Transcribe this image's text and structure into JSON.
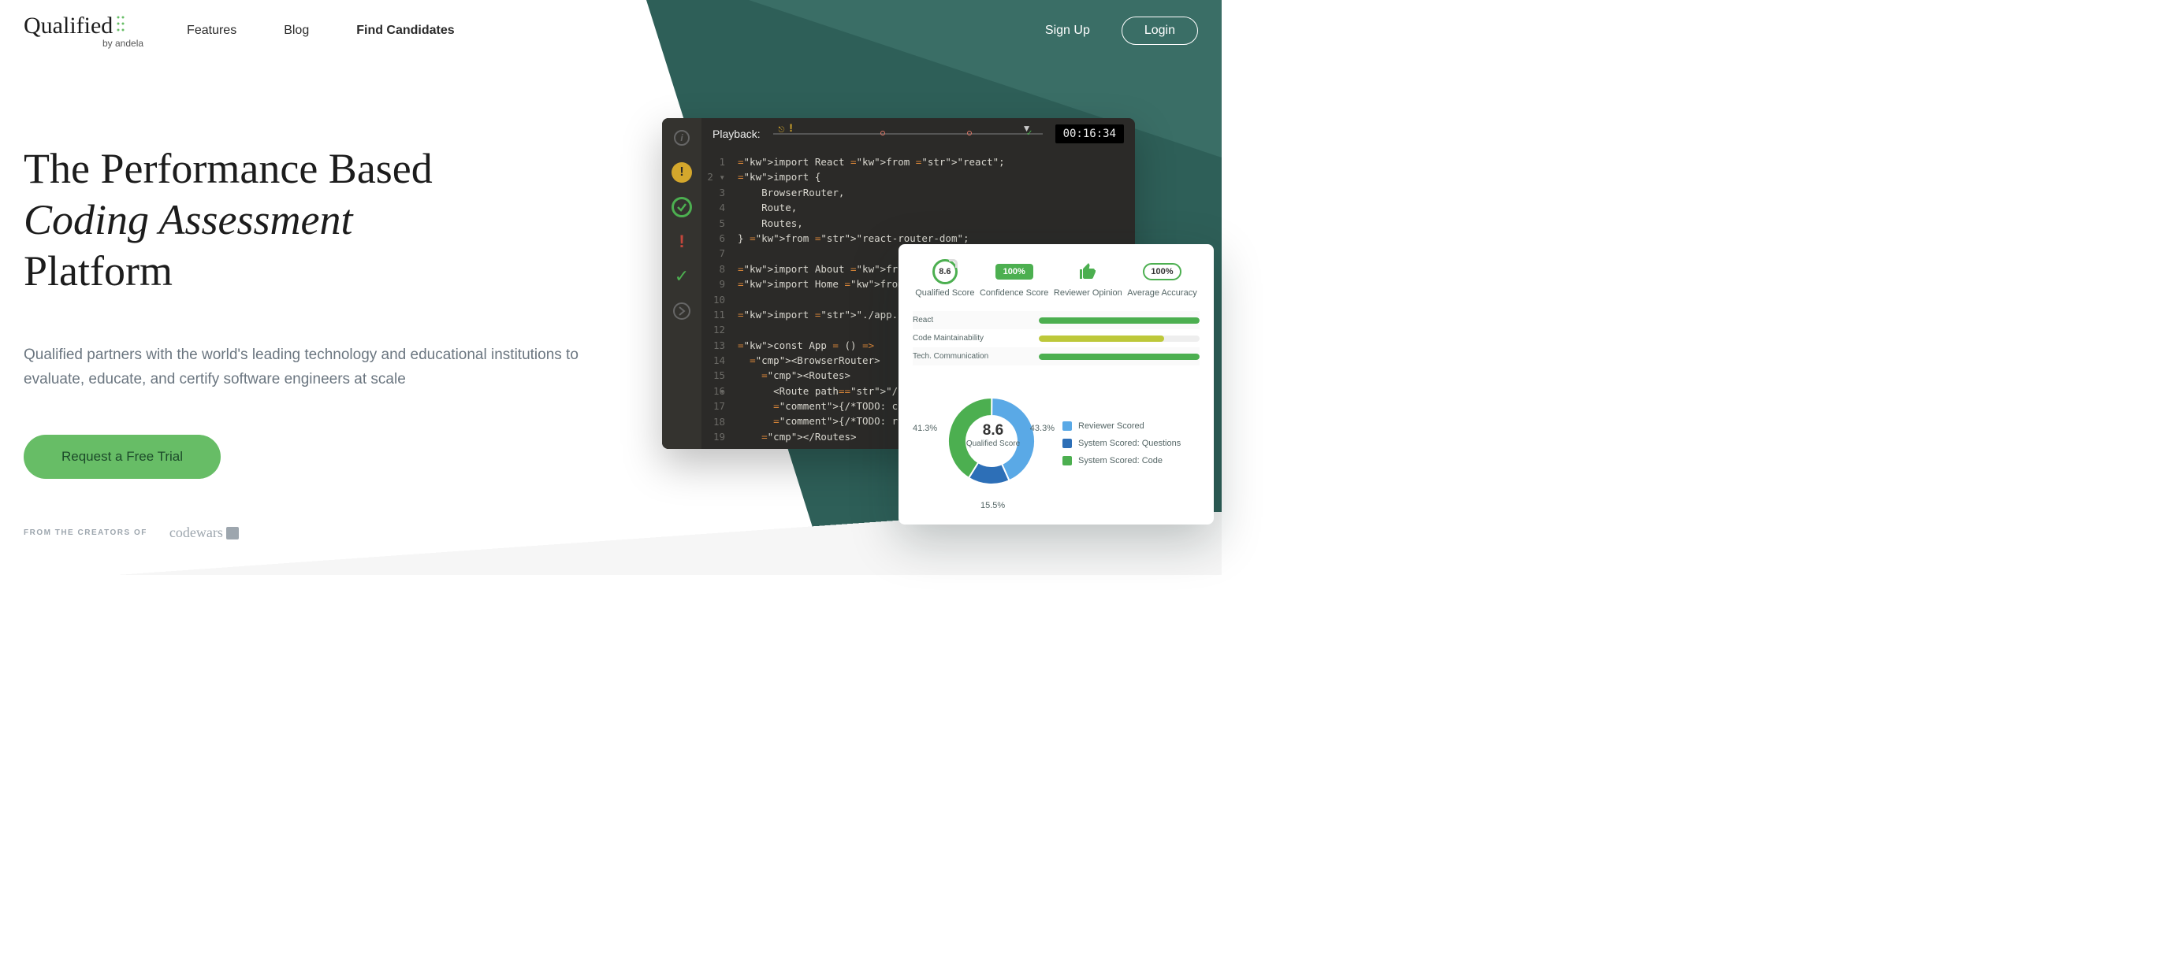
{
  "logo": {
    "text": "Qualified",
    "sub": "by andela"
  },
  "nav": {
    "features": "Features",
    "blog": "Blog",
    "find": "Find Candidates"
  },
  "auth": {
    "signup": "Sign Up",
    "login": "Login"
  },
  "hero": {
    "line1": "The Performance Based",
    "line2": "Coding Assessment",
    "line3": "Platform",
    "sub": "Qualified partners with the world's leading technology and educational institutions to evaluate, educate, and certify software engineers at scale",
    "cta": "Request a Free Trial",
    "creators_label": "FROM THE CREATORS OF",
    "codewars": "codewars"
  },
  "editor": {
    "playback": "Playback:",
    "timer": "00:16:34",
    "code_lines": [
      {
        "n": "1",
        "t": "import React from \"react\";"
      },
      {
        "n": "2 ▾",
        "t": "import {"
      },
      {
        "n": "3",
        "t": "    BrowserRouter,"
      },
      {
        "n": "4",
        "t": "    Route,"
      },
      {
        "n": "5",
        "t": "    Routes,"
      },
      {
        "n": "6",
        "t": "} from \"react-router-dom\";"
      },
      {
        "n": "7",
        "t": ""
      },
      {
        "n": "8",
        "t": "import About from \"./componer"
      },
      {
        "n": "9",
        "t": "import Home from \"./componer"
      },
      {
        "n": "10",
        "t": ""
      },
      {
        "n": "11",
        "t": "import \"./app.css\";"
      },
      {
        "n": "12",
        "t": ""
      },
      {
        "n": "13",
        "t": "const App = () =>"
      },
      {
        "n": "14",
        "t": "  <BrowserRouter>"
      },
      {
        "n": "15 ▾",
        "t": "    <Routes>"
      },
      {
        "n": "16",
        "t": "      <Route path=\"/\" elemer"
      },
      {
        "n": "17",
        "t": "      {/*TODO: create '/abou"
      },
      {
        "n": "18",
        "t": "      {/*TODO: redirect ever"
      },
      {
        "n": "19",
        "t": "    </Routes>"
      }
    ]
  },
  "score": {
    "qualified": {
      "value": "8.6",
      "label": "Qualified Score"
    },
    "confidence": {
      "value": "100%",
      "label": "Confidence Score"
    },
    "reviewer": {
      "label": "Reviewer Opinion"
    },
    "accuracy": {
      "value": "100%",
      "label": "Average Accuracy"
    },
    "bars": [
      {
        "label": "React",
        "pct": 100,
        "color": "#4caf50"
      },
      {
        "label": "Code Maintainability",
        "pct": 78,
        "color": "#bdc83a"
      },
      {
        "label": "Tech. Communication",
        "pct": 100,
        "color": "#4caf50"
      }
    ],
    "donut": {
      "center_big": "8.6",
      "center_small": "Qualified Score",
      "slices": [
        {
          "label": "43.3%",
          "color": "#5aa9e6",
          "pct": 43.3
        },
        {
          "label": "15.5%",
          "color": "#2d6fb7",
          "pct": 15.5
        },
        {
          "label": "41.3%",
          "color": "#4caf50",
          "pct": 41.3
        }
      ],
      "legend": [
        {
          "label": "Reviewer Scored",
          "color": "#5aa9e6"
        },
        {
          "label": "System Scored: Questions",
          "color": "#2d6fb7"
        },
        {
          "label": "System Scored: Code",
          "color": "#4caf50"
        }
      ],
      "pct_left": "41.3%",
      "pct_right": "43.3%",
      "pct_bottom": "15.5%"
    }
  }
}
